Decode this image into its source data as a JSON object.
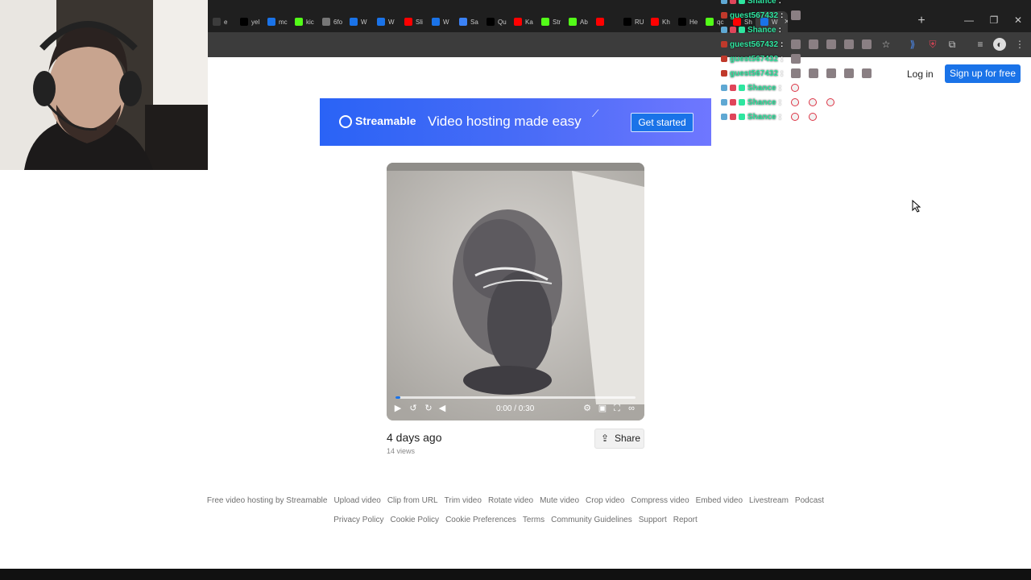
{
  "browser": {
    "tabs": [
      {
        "label": "e",
        "icon": "generic-icon",
        "color": "#3c3c3c"
      },
      {
        "label": "yel",
        "icon": "x-icon",
        "color": "#000000"
      },
      {
        "label": "mc",
        "icon": "streamable-icon",
        "color": "#1a73e8"
      },
      {
        "label": "kic",
        "icon": "kick-icon",
        "color": "#53fc18"
      },
      {
        "label": "6fo",
        "icon": "globe-icon",
        "color": "#777777"
      },
      {
        "label": "W",
        "icon": "streamable-icon",
        "color": "#1a73e8"
      },
      {
        "label": "W",
        "icon": "streamable-icon",
        "color": "#1a73e8"
      },
      {
        "label": "Sli",
        "icon": "youtube-icon",
        "color": "#ff0000"
      },
      {
        "label": "W",
        "icon": "streamable-icon",
        "color": "#1a73e8"
      },
      {
        "label": "Sa",
        "icon": "check-icon",
        "color": "#3b82f6"
      },
      {
        "label": "Qu",
        "icon": "tiktok-icon",
        "color": "#000000"
      },
      {
        "label": "Ka",
        "icon": "youtube-icon",
        "color": "#ff0000"
      },
      {
        "label": "Str",
        "icon": "kick-icon",
        "color": "#53fc18"
      },
      {
        "label": "Ab",
        "icon": "kick-icon",
        "color": "#53fc18"
      },
      {
        "label": "",
        "icon": "youtube-icon",
        "color": "#ff0000"
      },
      {
        "label": "RU",
        "icon": "x-icon",
        "color": "#000000"
      },
      {
        "label": "Kh",
        "icon": "youtube-icon",
        "color": "#ff0000"
      },
      {
        "label": "He",
        "icon": "x-icon",
        "color": "#000000"
      },
      {
        "label": "qc",
        "icon": "kick-icon",
        "color": "#53fc18"
      },
      {
        "label": "Sh",
        "icon": "youtube-icon",
        "color": "#ff0000"
      },
      {
        "label": "W",
        "icon": "streamable-icon",
        "color": "#1a73e8"
      }
    ],
    "active_tab_close": "×",
    "new_tab": "+",
    "window_controls": {
      "minimize": "—",
      "maximize": "❐",
      "close": "✕"
    }
  },
  "header": {
    "login": "Log in",
    "signup": "Sign up for free"
  },
  "banner": {
    "brand": "Streamable",
    "tagline": "Video hosting made easy",
    "cta": "Get started",
    "accent": "#2a63f6"
  },
  "video": {
    "current_time": "0:00",
    "duration": "0:30",
    "time_display": "0:00 / 0:30",
    "progress": 0.02
  },
  "meta": {
    "posted": "4 days ago",
    "views": "14 views",
    "share": "Share"
  },
  "footer": {
    "row1": [
      "Free video hosting by Streamable",
      "Upload video",
      "Clip from URL",
      "Trim video",
      "Rotate video",
      "Mute video",
      "Crop video",
      "Compress video",
      "Embed video",
      "Livestream",
      "Podcast"
    ],
    "row2": [
      "Privacy Policy",
      "Cookie Policy",
      "Cookie Preferences",
      "Terms",
      "Community Guidelines",
      "Support",
      "Report"
    ]
  },
  "chat": [
    {
      "user": "Shance",
      "emotes": 0,
      "color": "#2ee6a0"
    },
    {
      "user": "guest567432",
      "emotes": 1,
      "color": "#2ee6a0"
    },
    {
      "user": "Shance",
      "emotes": 0,
      "color": "#2ee6a0"
    },
    {
      "user": "guest567432",
      "emotes": 5,
      "color": "#2ee6a0"
    },
    {
      "user": "guest567432",
      "emotes": 1,
      "color": "#2ee6a0"
    },
    {
      "user": "guest567432",
      "emotes": 5,
      "color": "#2ee6a0"
    },
    {
      "user": "Shance",
      "emotes": 1,
      "color": "#2ee6a0"
    },
    {
      "user": "Shance",
      "emotes": 3,
      "color": "#2ee6a0"
    },
    {
      "user": "Shance",
      "emotes": 2,
      "color": "#2ee6a0"
    }
  ]
}
